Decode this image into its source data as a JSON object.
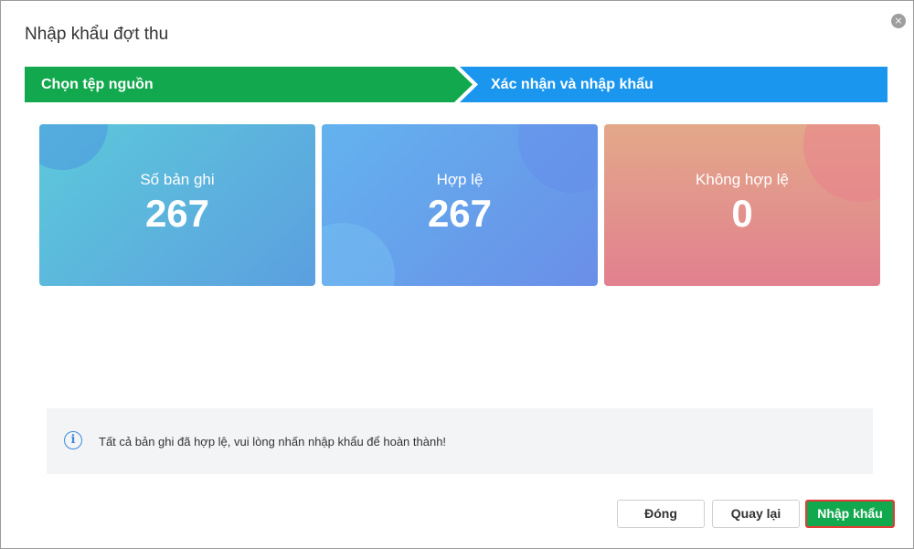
{
  "dialog": {
    "title": "Nhập khẩu đợt thu",
    "close_icon": "×"
  },
  "steps": [
    {
      "label": "Chọn tệp nguồn",
      "color": "#12a84e"
    },
    {
      "label": "Xác nhận và nhập khẩu",
      "color": "#1a96ef"
    }
  ],
  "stats": [
    {
      "label": "Số bản ghi",
      "value": "267"
    },
    {
      "label": "Hợp lệ",
      "value": "267"
    },
    {
      "label": "Không hợp lệ",
      "value": "0"
    }
  ],
  "info": {
    "icon": "i",
    "message": "Tất cả bản ghi đã hợp lệ, vui lòng nhấn nhập khẩu để hoàn thành!"
  },
  "buttons": {
    "close": "Đóng",
    "back": "Quay lại",
    "import": "Nhập khẩu"
  },
  "colors": {
    "primary_green": "#12a84e",
    "step_blue": "#1a96ef",
    "highlight_border": "#e53935"
  }
}
